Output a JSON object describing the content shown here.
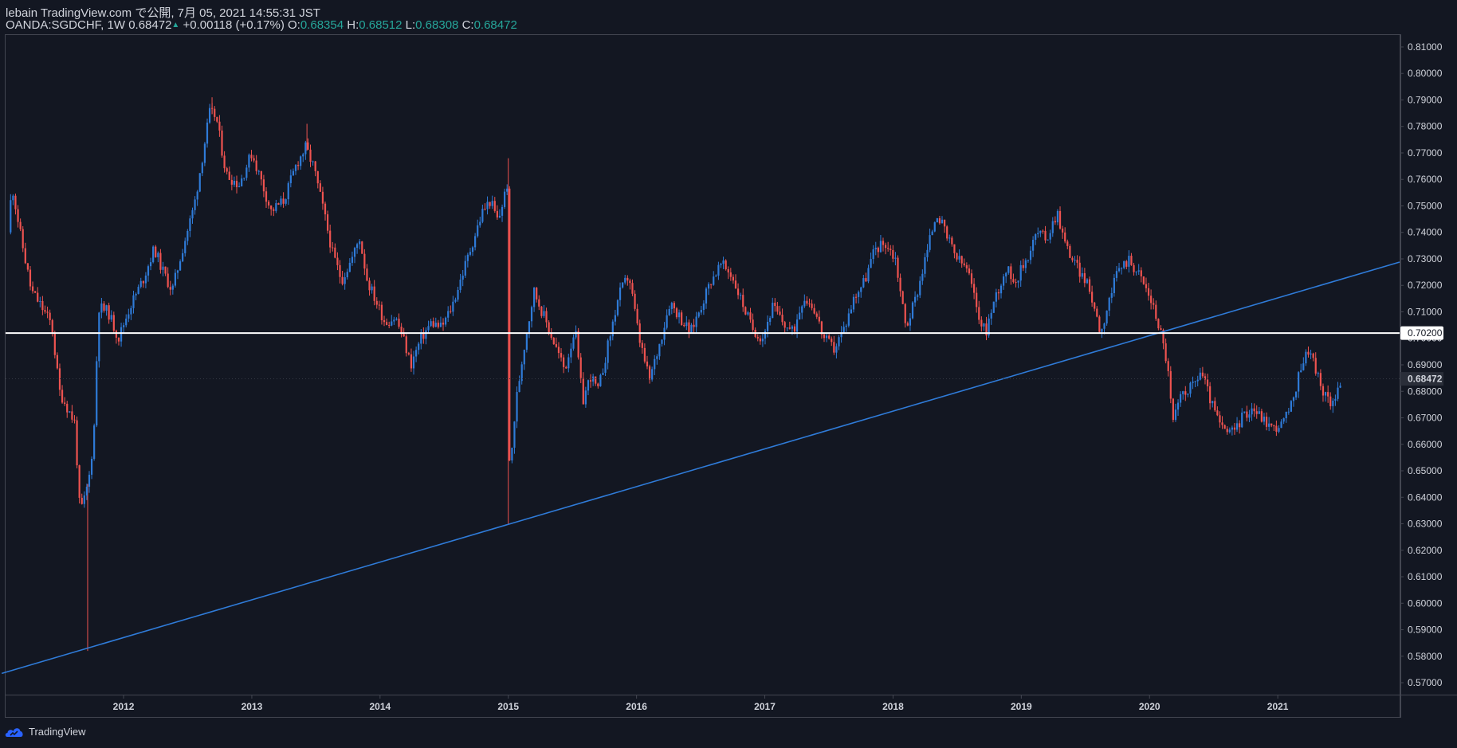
{
  "header": {
    "published_line": "lebain TradingView.com で公開, 7月 05, 2021 14:55:31 JST",
    "symbol": "OANDA:SGDCHF, 1W",
    "last": "0.68472",
    "change": "+0.00118 (+0.17%)",
    "o_label": "O:",
    "o_value": "0.68354",
    "h_label": "H:",
    "h_value": "0.68512",
    "l_label": "L:",
    "l_value": "0.68308",
    "c_label": "C:",
    "c_value": "0.68472"
  },
  "footer": {
    "brand": "TradingView"
  },
  "colors": {
    "background": "#131722",
    "up": "#2f7bd8",
    "down": "#ef5350",
    "trendline": "#2f7bd8",
    "level": "#ffffff",
    "axis_text": "#d1d4dc"
  },
  "chart_data": {
    "type": "candlestick",
    "title": "OANDA:SGDCHF, 1W",
    "x_ticks": [
      "2012",
      "2013",
      "2014",
      "2015",
      "2016",
      "2017",
      "2018",
      "2019",
      "2020",
      "2021"
    ],
    "y_ticks": [
      "0.57000",
      "0.58000",
      "0.59000",
      "0.60000",
      "0.61000",
      "0.62000",
      "0.63000",
      "0.64000",
      "0.65000",
      "0.66000",
      "0.67000",
      "0.68000",
      "0.69000",
      "0.70000",
      "0.71000",
      "0.72000",
      "0.73000",
      "0.74000",
      "0.75000",
      "0.76000",
      "0.77000",
      "0.78000",
      "0.79000",
      "0.80000",
      "0.81000"
    ],
    "ylim": [
      0.5655,
      0.8145
    ],
    "xlim": [
      2011.08,
      2021.95
    ],
    "close_path": [
      [
        2011.1,
        0.74
      ],
      [
        2011.13,
        0.758
      ],
      [
        2011.2,
        0.738
      ],
      [
        2011.28,
        0.718
      ],
      [
        2011.36,
        0.712
      ],
      [
        2011.44,
        0.705
      ],
      [
        2011.5,
        0.68
      ],
      [
        2011.56,
        0.674
      ],
      [
        2011.62,
        0.668
      ],
      [
        2011.66,
        0.634
      ],
      [
        2011.7,
        0.64
      ],
      [
        2011.74,
        0.65
      ],
      [
        2011.78,
        0.672
      ],
      [
        2011.8,
        0.712
      ],
      [
        2011.88,
        0.71
      ],
      [
        2011.96,
        0.7
      ],
      [
        2012.05,
        0.712
      ],
      [
        2012.15,
        0.722
      ],
      [
        2012.24,
        0.734
      ],
      [
        2012.3,
        0.726
      ],
      [
        2012.38,
        0.718
      ],
      [
        2012.45,
        0.732
      ],
      [
        2012.55,
        0.75
      ],
      [
        2012.62,
        0.77
      ],
      [
        2012.67,
        0.785
      ],
      [
        2012.72,
        0.784
      ],
      [
        2012.8,
        0.762
      ],
      [
        2012.9,
        0.758
      ],
      [
        2013.0,
        0.77
      ],
      [
        2013.07,
        0.76
      ],
      [
        2013.15,
        0.748
      ],
      [
        2013.25,
        0.752
      ],
      [
        2013.35,
        0.766
      ],
      [
        2013.42,
        0.772
      ],
      [
        2013.48,
        0.765
      ],
      [
        2013.56,
        0.748
      ],
      [
        2013.63,
        0.732
      ],
      [
        2013.7,
        0.722
      ],
      [
        2013.78,
        0.73
      ],
      [
        2013.84,
        0.738
      ],
      [
        2013.9,
        0.722
      ],
      [
        2013.96,
        0.715
      ],
      [
        2014.04,
        0.706
      ],
      [
        2014.12,
        0.708
      ],
      [
        2014.18,
        0.7
      ],
      [
        2014.24,
        0.69
      ],
      [
        2014.32,
        0.7
      ],
      [
        2014.4,
        0.706
      ],
      [
        2014.48,
        0.704
      ],
      [
        2014.56,
        0.712
      ],
      [
        2014.64,
        0.724
      ],
      [
        2014.72,
        0.736
      ],
      [
        2014.8,
        0.748
      ],
      [
        2014.86,
        0.752
      ],
      [
        2014.92,
        0.744
      ],
      [
        2014.96,
        0.752
      ],
      [
        2015.0,
        0.76
      ],
      [
        2015.01,
        0.648
      ],
      [
        2015.06,
        0.676
      ],
      [
        2015.12,
        0.696
      ],
      [
        2015.2,
        0.718
      ],
      [
        2015.28,
        0.708
      ],
      [
        2015.36,
        0.698
      ],
      [
        2015.44,
        0.688
      ],
      [
        2015.52,
        0.704
      ],
      [
        2015.58,
        0.676
      ],
      [
        2015.64,
        0.686
      ],
      [
        2015.7,
        0.68
      ],
      [
        2015.78,
        0.698
      ],
      [
        2015.86,
        0.716
      ],
      [
        2015.94,
        0.724
      ],
      [
        2016.02,
        0.7
      ],
      [
        2016.1,
        0.684
      ],
      [
        2016.18,
        0.698
      ],
      [
        2016.26,
        0.714
      ],
      [
        2016.34,
        0.708
      ],
      [
        2016.42,
        0.702
      ],
      [
        2016.5,
        0.712
      ],
      [
        2016.58,
        0.722
      ],
      [
        2016.66,
        0.728
      ],
      [
        2016.74,
        0.724
      ],
      [
        2016.82,
        0.714
      ],
      [
        2016.9,
        0.704
      ],
      [
        2016.98,
        0.7
      ],
      [
        2017.06,
        0.712
      ],
      [
        2017.14,
        0.706
      ],
      [
        2017.22,
        0.702
      ],
      [
        2017.3,
        0.716
      ],
      [
        2017.38,
        0.712
      ],
      [
        2017.46,
        0.7
      ],
      [
        2017.54,
        0.696
      ],
      [
        2017.62,
        0.704
      ],
      [
        2017.7,
        0.716
      ],
      [
        2017.78,
        0.722
      ],
      [
        2017.86,
        0.734
      ],
      [
        2017.94,
        0.736
      ],
      [
        2018.02,
        0.73
      ],
      [
        2018.1,
        0.704
      ],
      [
        2018.18,
        0.716
      ],
      [
        2018.26,
        0.732
      ],
      [
        2018.34,
        0.748
      ],
      [
        2018.42,
        0.738
      ],
      [
        2018.5,
        0.73
      ],
      [
        2018.58,
        0.726
      ],
      [
        2018.66,
        0.71
      ],
      [
        2018.72,
        0.702
      ],
      [
        2018.8,
        0.716
      ],
      [
        2018.88,
        0.726
      ],
      [
        2018.96,
        0.722
      ],
      [
        2019.04,
        0.73
      ],
      [
        2019.12,
        0.74
      ],
      [
        2019.2,
        0.738
      ],
      [
        2019.28,
        0.748
      ],
      [
        2019.34,
        0.736
      ],
      [
        2019.42,
        0.728
      ],
      [
        2019.5,
        0.722
      ],
      [
        2019.56,
        0.714
      ],
      [
        2019.62,
        0.702
      ],
      [
        2019.68,
        0.714
      ],
      [
        2019.76,
        0.726
      ],
      [
        2019.84,
        0.73
      ],
      [
        2019.92,
        0.724
      ],
      [
        2020.0,
        0.716
      ],
      [
        2020.08,
        0.704
      ],
      [
        2020.14,
        0.69
      ],
      [
        2020.18,
        0.668
      ],
      [
        2020.26,
        0.68
      ],
      [
        2020.34,
        0.682
      ],
      [
        2020.4,
        0.688
      ],
      [
        2020.48,
        0.676
      ],
      [
        2020.56,
        0.666
      ],
      [
        2020.64,
        0.664
      ],
      [
        2020.72,
        0.67
      ],
      [
        2020.8,
        0.674
      ],
      [
        2020.88,
        0.67
      ],
      [
        2020.96,
        0.666
      ],
      [
        2021.04,
        0.668
      ],
      [
        2021.12,
        0.676
      ],
      [
        2021.18,
        0.69
      ],
      [
        2021.24,
        0.696
      ],
      [
        2021.3,
        0.688
      ],
      [
        2021.36,
        0.678
      ],
      [
        2021.42,
        0.676
      ],
      [
        2021.5,
        0.6847
      ]
    ],
    "spikes": [
      {
        "x": 2011.72,
        "low": 0.582
      },
      {
        "x": 2012.69,
        "high": 0.791
      },
      {
        "x": 2013.43,
        "high": 0.781
      },
      {
        "x": 2015.0,
        "high": 0.768,
        "low": 0.63
      }
    ],
    "trendline": {
      "from": [
        2011.05,
        0.5735
      ],
      "to": [
        2021.95,
        0.7288
      ]
    },
    "level_line": {
      "value": 0.702,
      "label": "0.70200"
    },
    "last_price_label": "0.68472"
  }
}
